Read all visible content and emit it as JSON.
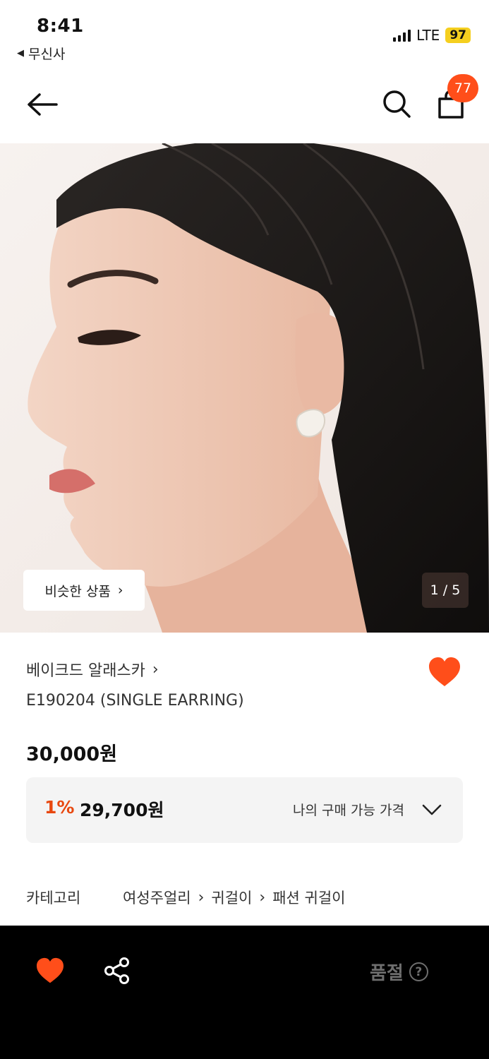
{
  "status_bar": {
    "time": "8:41",
    "back_app": "무신사",
    "network": "LTE",
    "battery": "97"
  },
  "header": {
    "back_icon": "arrow-left-icon",
    "search_icon": "search-icon",
    "bag_icon": "shopping-bag-icon",
    "cart_count": "77"
  },
  "gallery": {
    "similar_label": "비슷한 상품",
    "pager": "1 / 5"
  },
  "product": {
    "brand": "베이크드 알래스카",
    "name": "E190204 (SINGLE EARRING)",
    "price": "30,000원",
    "my_price_percent": "1%",
    "my_price_amount": "29,700원",
    "my_price_label": "나의 구매 가능 가격",
    "liked": true
  },
  "category": {
    "label": "카테고리",
    "path": [
      "여성주얼리",
      "귀걸이",
      "패션 귀걸이"
    ]
  },
  "bottom_bar": {
    "status": "품절",
    "help": "?"
  },
  "colors": {
    "accent": "#ff4e1a",
    "discount": "#e8480f",
    "bottom_bar": "#000000",
    "soldout_text": "#6e6e6e"
  }
}
